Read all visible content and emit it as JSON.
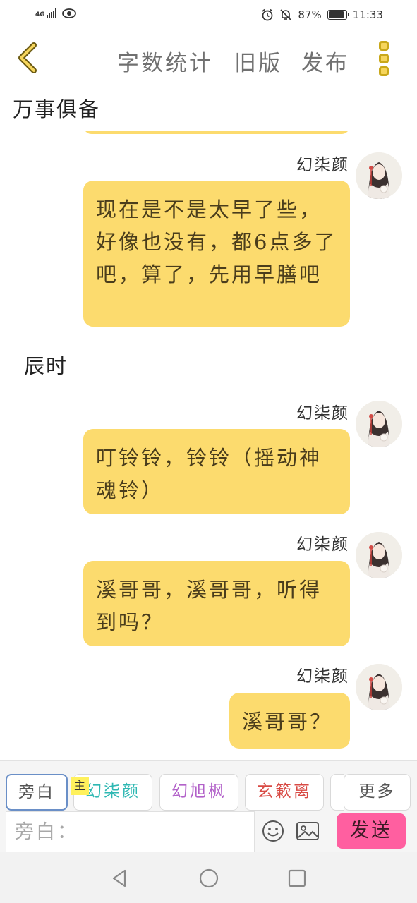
{
  "status_bar": {
    "network": "4G",
    "battery": "87%",
    "battery_level": 0.87,
    "time": "11:33"
  },
  "nav": {
    "word_count": "字数统计",
    "old_version": "旧版",
    "publish": "发布"
  },
  "chapter_title": "万事俱备",
  "messages": [
    {
      "type": "bubble",
      "name": "幻柒颜",
      "text": "现在是不是太早了些，好像也没有，都6点多了吧，算了，先用早膳吧"
    },
    {
      "type": "narration",
      "text": "辰时"
    },
    {
      "type": "bubble",
      "name": "幻柒颜",
      "text": "叮铃铃，铃铃（摇动神魂铃）"
    },
    {
      "type": "bubble",
      "name": "幻柒颜",
      "text": "溪哥哥，溪哥哥，听得到吗？"
    },
    {
      "type": "bubble",
      "name": "幻柒颜",
      "text": "溪哥哥？"
    }
  ],
  "roles": {
    "main_tag": "主",
    "items": [
      {
        "label": "旁白",
        "color": "#555555"
      },
      {
        "label": "幻柒颜",
        "color": "#2fb8b3"
      },
      {
        "label": "幻旭枫",
        "color": "#b261c9"
      },
      {
        "label": "玄簌离",
        "color": "#d84a44"
      }
    ],
    "more": "更多"
  },
  "input": {
    "placeholder": "旁白：",
    "send": "发送"
  },
  "colors": {
    "bubble": "#fcdb6e",
    "send": "#ff5fa0",
    "menu_accent": "#f6d55c"
  }
}
